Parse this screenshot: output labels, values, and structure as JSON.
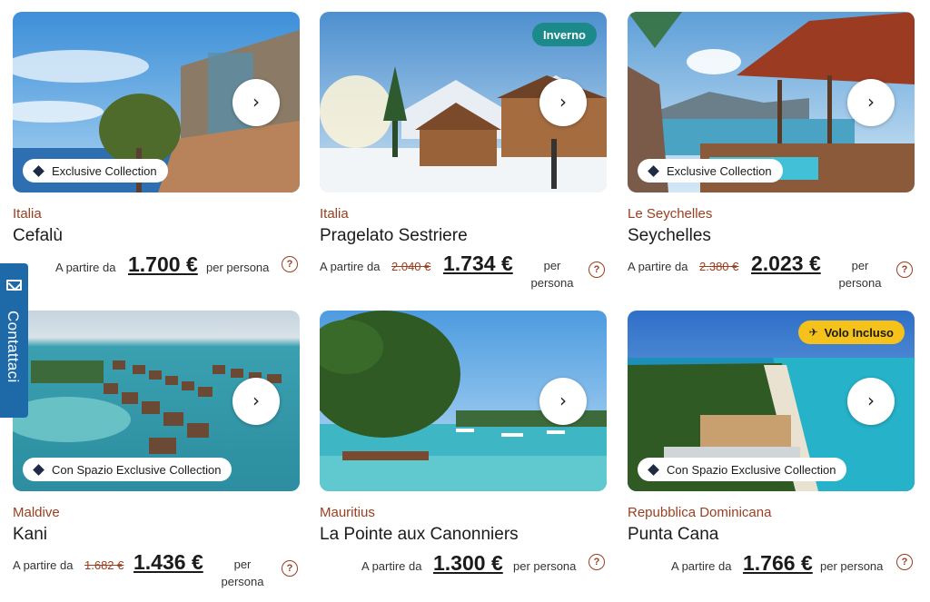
{
  "cards": [
    {
      "country": "Italia",
      "name": "Cefalù",
      "badge": "Exclusive Collection",
      "from_label": "A partire da",
      "price": "1.700 €",
      "per_person": "per persona",
      "help": "?"
    },
    {
      "country": "Italia",
      "name": "Pragelato Sestriere",
      "tag": "Inverno",
      "from_label": "A partire da",
      "old_price": "2.040 €",
      "price": "1.734 €",
      "per": "per",
      "persona": "persona",
      "help": "?"
    },
    {
      "country": "Le Seychelles",
      "name": "Seychelles",
      "badge": "Exclusive Collection",
      "from_label": "A partire da",
      "old_price": "2.380 €",
      "price": "2.023 €",
      "per": "per",
      "persona": "persona",
      "help": "?"
    },
    {
      "country": "Maldive",
      "name": "Kani",
      "badge": "Con Spazio Exclusive Collection",
      "from_label": "A partire da",
      "old_price": "1.682 €",
      "price": "1.436 €",
      "per": "per",
      "persona": "persona",
      "help": "?"
    },
    {
      "country": "Mauritius",
      "name": "La Pointe aux Canonniers",
      "from_label": "A partire da",
      "price": "1.300 €",
      "per_person": "per persona",
      "help": "?"
    },
    {
      "country": "Repubblica Dominicana",
      "name": "Punta Cana",
      "tag": "Volo Incluso",
      "badge": "Con Spazio Exclusive Collection",
      "from_label": "A partire da",
      "price": "1.766 €",
      "per_person": "per persona",
      "help": "?"
    }
  ],
  "arrow_glyph": "›",
  "plane_glyph": "✈",
  "contact_tab": "Contattaci",
  "icons": [
    "chevron-right-icon",
    "diamond-icon",
    "help-icon",
    "envelope-icon",
    "plane-icon"
  ],
  "colors": {
    "accent": "#9a3e20",
    "winter_tag": "#1c8a8a",
    "flight_tag": "#f4c21b",
    "contact_tab": "#1e6aa8",
    "diamond": "#1f2a44"
  }
}
